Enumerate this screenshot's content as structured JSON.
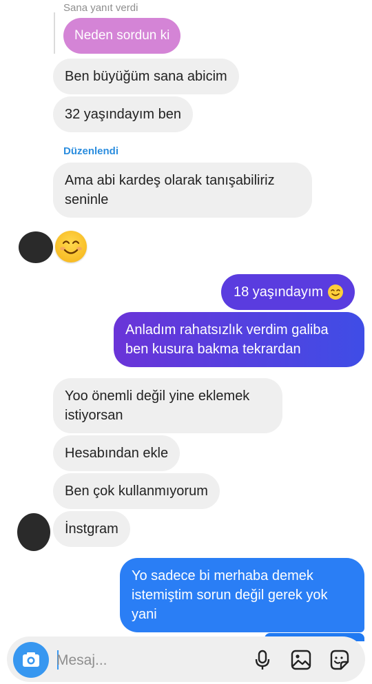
{
  "colors": {
    "incoming_bg": "#efefef",
    "reply_bubble": "#d484d6",
    "outgoing_purple": "#5c3ee0",
    "outgoing_blue": "#2a7ef5",
    "edited_label": "#2b8dde",
    "camera_button": "#3797f0"
  },
  "reply": {
    "label": "Sana yanıt verdi",
    "quoted": "Neden sordun ki"
  },
  "messages_top": [
    {
      "text": "Ben büyüğüm sana abicim"
    },
    {
      "text": "32 yaşındayım ben"
    }
  ],
  "edited_label": "Düzenlendi",
  "edited_message": {
    "text": "Ama abi kardeş olarak tanışabiliriz seninle"
  },
  "outgoing_1": {
    "text": "18 yaşındayım",
    "emoji_icon": "smiling-face-icon"
  },
  "outgoing_2": {
    "text": "Anladım rahatsızlık verdim galiba ben kusura bakma tekrardan"
  },
  "incoming_group": [
    {
      "text": "Yoo önemli değil yine eklemek istiyorsan"
    },
    {
      "text": "Hesabından ekle"
    },
    {
      "text": "Ben çok kullanmıyorum"
    },
    {
      "text": "İnstgram"
    }
  ],
  "outgoing_3": {
    "text": "Yo sadece bi merhaba demek istemiştim sorun değil gerek yok yani"
  },
  "composer": {
    "placeholder": "Mesaj...",
    "icons": [
      "camera-icon",
      "microphone-icon",
      "gallery-icon",
      "sticker-icon"
    ]
  }
}
